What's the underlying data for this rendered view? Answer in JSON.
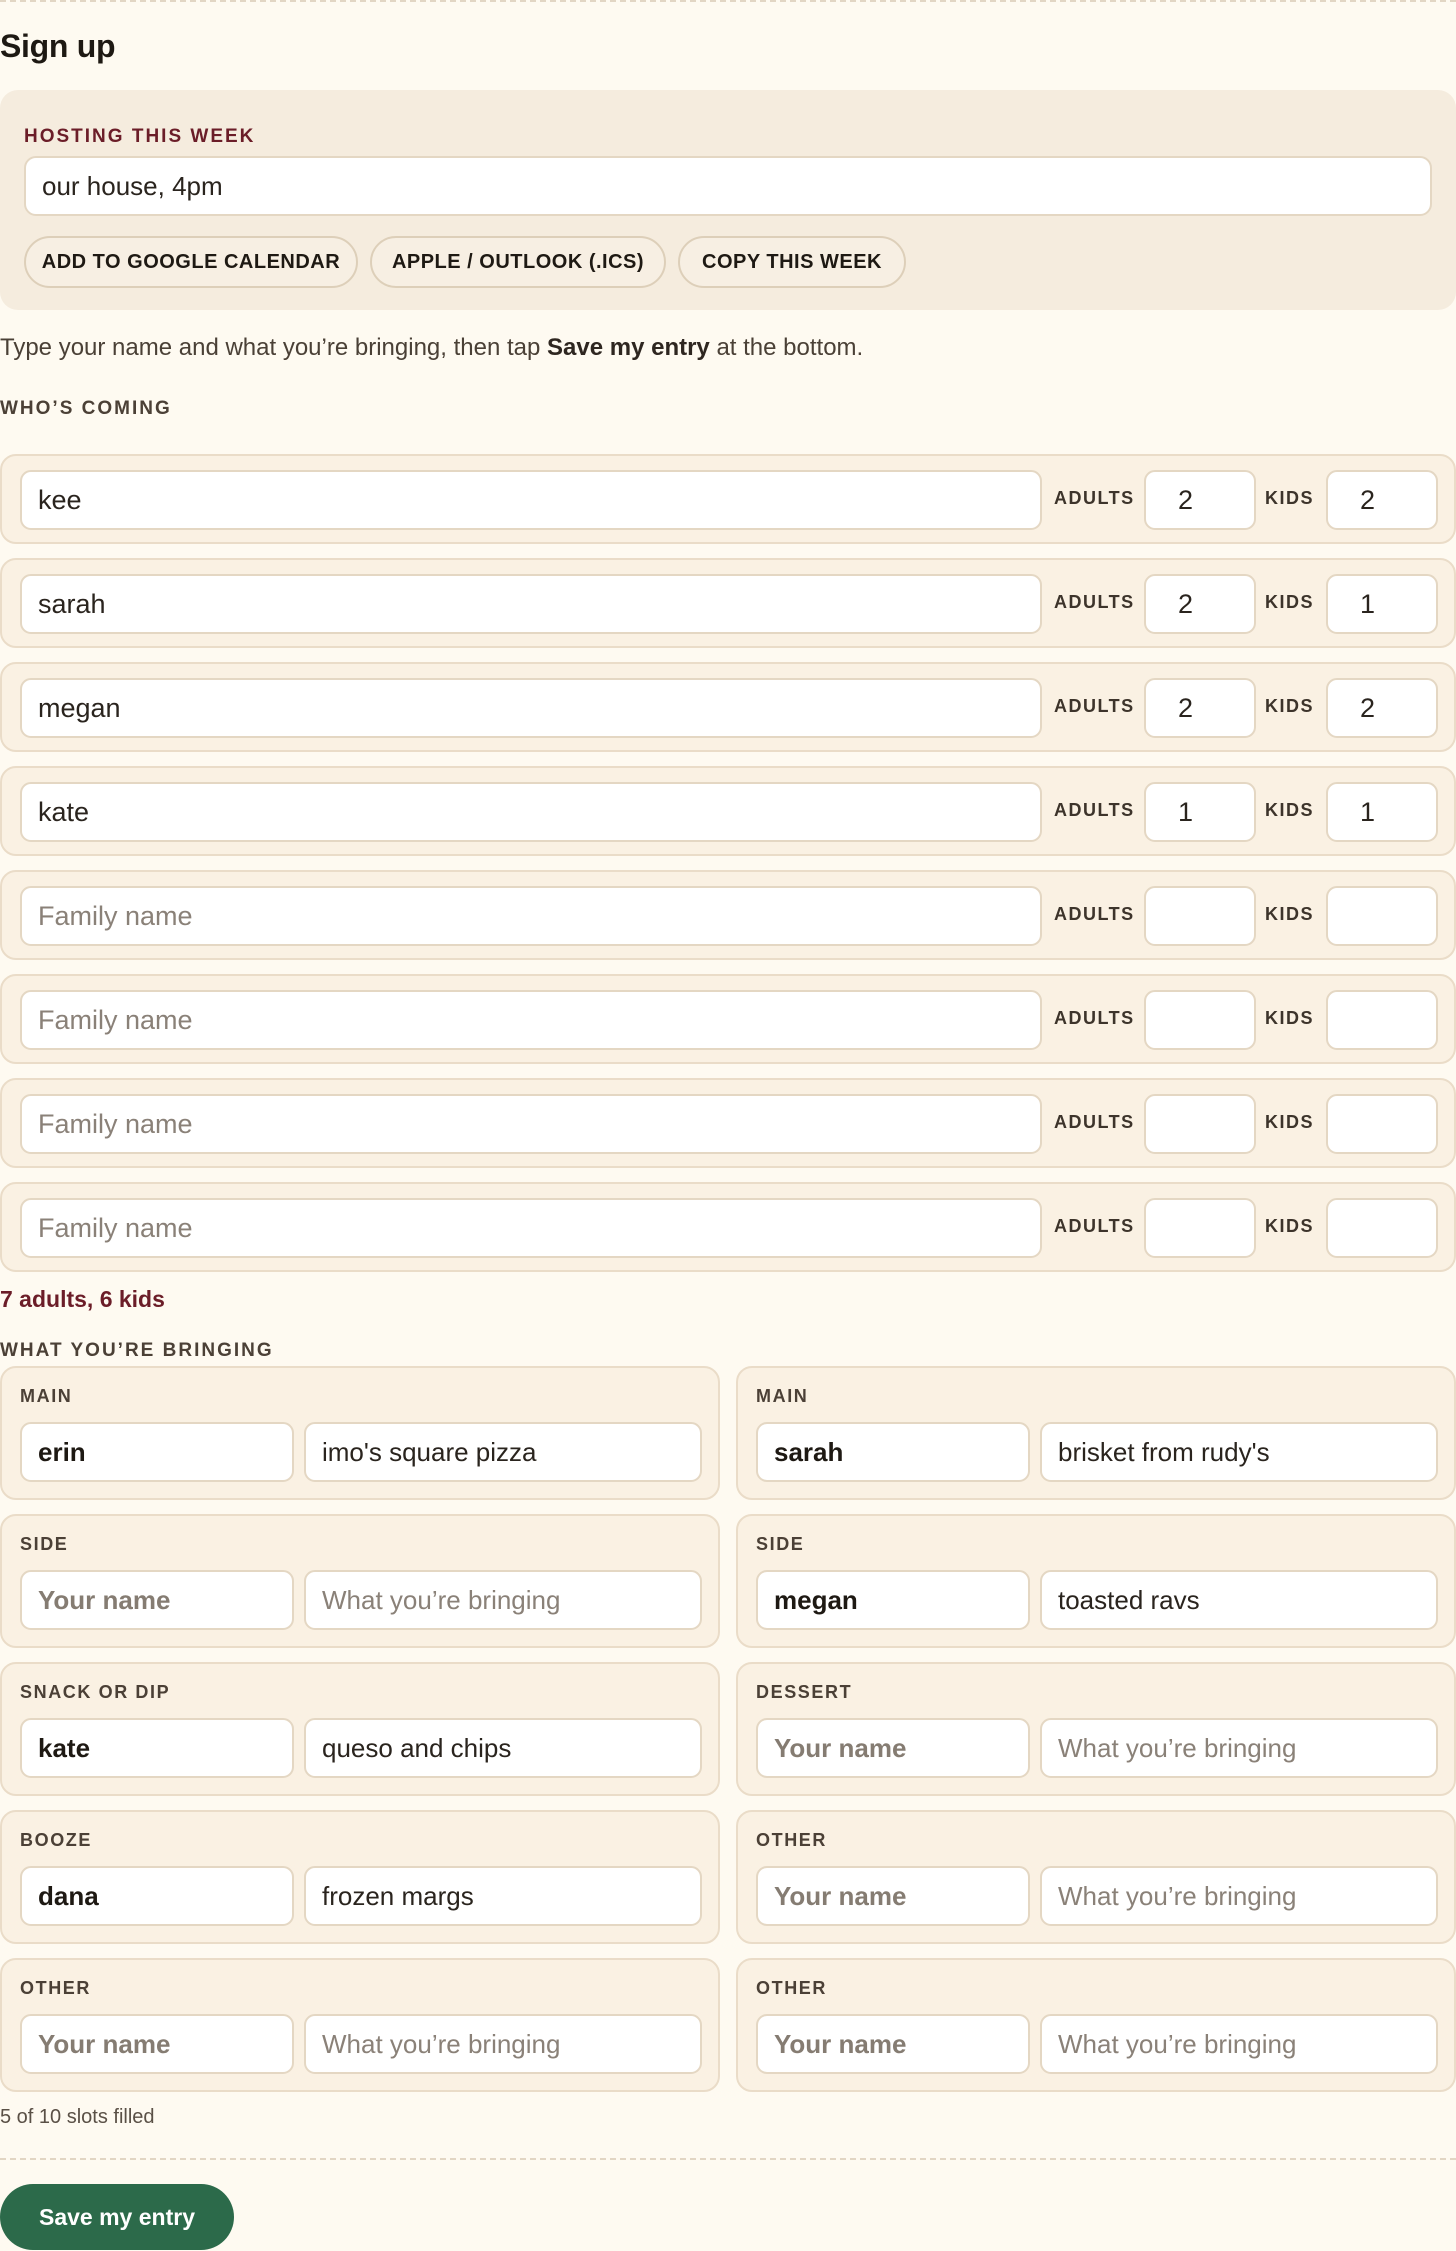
{
  "page": {
    "title": "Sign up"
  },
  "hosting": {
    "label": "HOSTING THIS WEEK",
    "value": "our house, 4pm",
    "buttons": {
      "google": "ADD TO GOOGLE CALENDAR",
      "ics": "APPLE / OUTLOOK (.ICS)",
      "copy": "COPY THIS WEEK"
    }
  },
  "instructions": {
    "before": "Type your name and what you’re bringing, then tap ",
    "bold": "Save my entry",
    "after": " at the bottom."
  },
  "whos_coming": {
    "label": "WHO’S COMING",
    "adults_label": "ADULTS",
    "kids_label": "KIDS",
    "name_placeholder": "Family name",
    "families": [
      {
        "name": "kee",
        "adults": "2",
        "kids": "2"
      },
      {
        "name": "sarah",
        "adults": "2",
        "kids": "1"
      },
      {
        "name": "megan",
        "adults": "2",
        "kids": "2"
      },
      {
        "name": "kate",
        "adults": "1",
        "kids": "1"
      },
      {
        "name": "",
        "adults": "",
        "kids": ""
      },
      {
        "name": "",
        "adults": "",
        "kids": ""
      },
      {
        "name": "",
        "adults": "",
        "kids": ""
      },
      {
        "name": "",
        "adults": "",
        "kids": ""
      }
    ],
    "totals": "7 adults, 6 kids"
  },
  "bringing": {
    "label": "WHAT YOU’RE BRINGING",
    "name_placeholder": "Your name",
    "item_placeholder": "What you’re bringing",
    "slots": [
      {
        "category": "MAIN",
        "name": "erin",
        "item": "imo's square pizza"
      },
      {
        "category": "MAIN",
        "name": "sarah",
        "item": "brisket from rudy's"
      },
      {
        "category": "SIDE",
        "name": "",
        "item": ""
      },
      {
        "category": "SIDE",
        "name": "megan",
        "item": "toasted ravs"
      },
      {
        "category": "SNACK OR DIP",
        "name": "kate",
        "item": "queso and chips"
      },
      {
        "category": "DESSERT",
        "name": "",
        "item": ""
      },
      {
        "category": "BOOZE",
        "name": "dana",
        "item": "frozen margs"
      },
      {
        "category": "OTHER",
        "name": "",
        "item": ""
      },
      {
        "category": "OTHER",
        "name": "",
        "item": ""
      },
      {
        "category": "OTHER",
        "name": "",
        "item": ""
      }
    ],
    "filled_text": "5 of 10 slots filled"
  },
  "actions": {
    "save": "Save my entry"
  },
  "colors": {
    "background": "#fefaf1",
    "card": "#f5ecde",
    "accent_maroon": "#6b1d28",
    "save_green": "#2c6a4a"
  }
}
